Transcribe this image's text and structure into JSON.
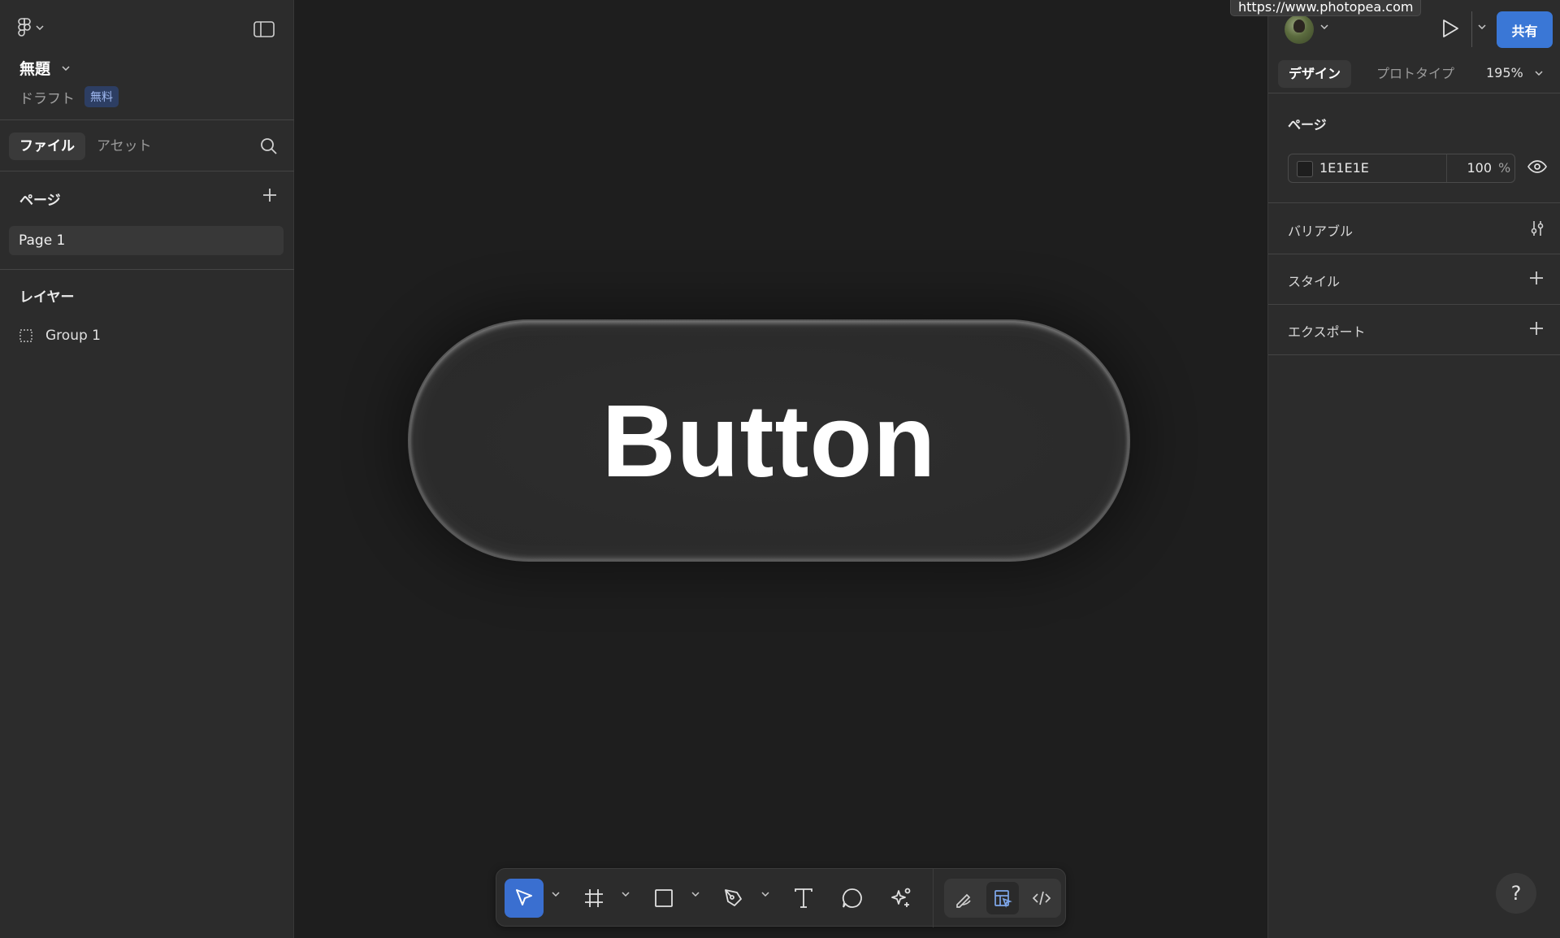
{
  "tooltip": {
    "url": "https://www.photopea.com"
  },
  "left_panel": {
    "file": {
      "title": "無題",
      "draft_label": "ドラフト",
      "plan_badge": "無料"
    },
    "tabs": [
      {
        "label": "ファイル"
      },
      {
        "label": "アセット"
      }
    ],
    "pages": {
      "title": "ページ",
      "items": [
        {
          "label": "Page 1"
        }
      ]
    },
    "layers": {
      "title": "レイヤー",
      "items": [
        {
          "label": "Group 1"
        }
      ]
    }
  },
  "canvas": {
    "button_text": "Button",
    "background_color": "#1E1E1E"
  },
  "toolbar": {
    "tools": [
      {
        "name": "move-tool",
        "icon": "cursor-arrow-icon",
        "selected": true
      },
      {
        "name": "frame-tool",
        "icon": "frame-grid-icon"
      },
      {
        "name": "shape-tool",
        "icon": "rectangle-icon"
      },
      {
        "name": "pen-tool",
        "icon": "pen-nib-icon"
      },
      {
        "name": "text-tool",
        "icon": "text-T-icon"
      },
      {
        "name": "comment-tool",
        "icon": "speech-bubble-icon"
      },
      {
        "name": "actions-tool",
        "icon": "sparkle-icon"
      }
    ],
    "modes": [
      {
        "icon": "draw-icon"
      },
      {
        "icon": "design-icon",
        "active": true
      },
      {
        "icon": "dev-code-icon"
      }
    ],
    "accent_color": "#3A6FD0"
  },
  "right_panel": {
    "share_label": "共有",
    "share_color": "#3A77D6",
    "tabs": [
      {
        "label": "デザイン"
      },
      {
        "label": "プロトタイプ"
      }
    ],
    "zoom": "195%",
    "page": {
      "title": "ページ",
      "color_hex": "1E1E1E",
      "opacity": "100",
      "opacity_unit": "%"
    },
    "sections": [
      {
        "title": "バリアブル"
      },
      {
        "title": "スタイル"
      },
      {
        "title": "エクスポート"
      }
    ],
    "help_label": "?"
  }
}
